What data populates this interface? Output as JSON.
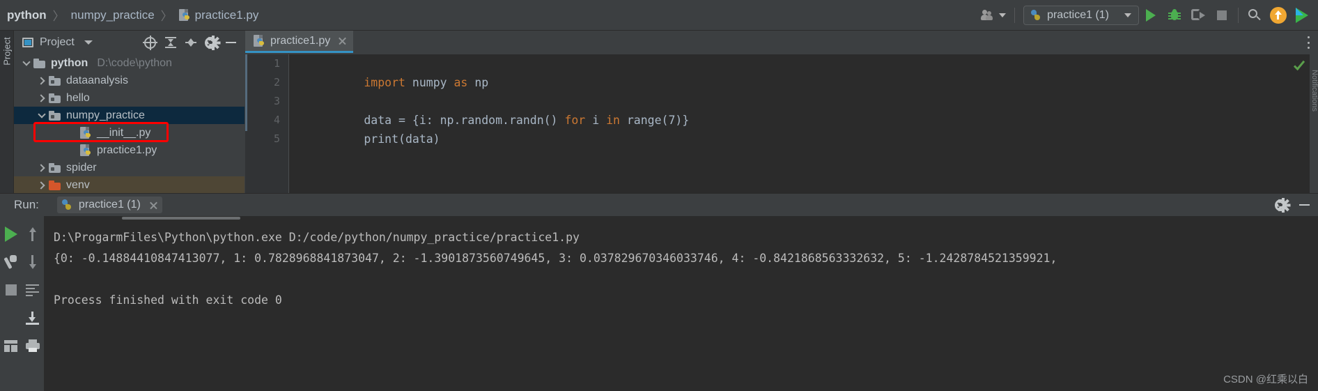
{
  "breadcrumb": {
    "items": [
      "python",
      "numpy_practice",
      "practice1.py"
    ],
    "separator": "〉"
  },
  "toolbar": {
    "run_config_label": "practice1 (1)",
    "icons": [
      "people-icon",
      "run-icon",
      "debug-icon",
      "coverage-icon",
      "stop-icon",
      "search-icon",
      "update-icon",
      "plugin-icon"
    ]
  },
  "left_strip": {
    "label": "Project"
  },
  "right_strip": {
    "label": "Notifications"
  },
  "project_panel": {
    "title": "Project",
    "header_icons": [
      "locate-icon",
      "collapse-all-icon",
      "expand-all-icon",
      "gear-icon",
      "minimize-icon"
    ],
    "tree": [
      {
        "label": "python",
        "path": "D:\\code\\python",
        "type": "root-folder",
        "expanded": true,
        "indent": 0,
        "bold": true
      },
      {
        "label": "dataanalysis",
        "path": "",
        "type": "source-folder",
        "expanded": false,
        "indent": 1,
        "bold": false
      },
      {
        "label": "hello",
        "path": "",
        "type": "source-folder",
        "expanded": false,
        "indent": 1,
        "bold": false
      },
      {
        "label": "numpy_practice",
        "path": "",
        "type": "source-folder",
        "expanded": true,
        "indent": 1,
        "bold": false,
        "selected": true,
        "highlighted": true
      },
      {
        "label": "__init__.py",
        "path": "",
        "type": "python-file",
        "indent": 2,
        "bold": false
      },
      {
        "label": "practice1.py",
        "path": "",
        "type": "python-file",
        "indent": 2,
        "bold": false
      },
      {
        "label": "spider",
        "path": "",
        "type": "source-folder",
        "expanded": false,
        "indent": 1,
        "bold": false
      },
      {
        "label": "venv",
        "path": "",
        "type": "excluded-folder",
        "expanded": false,
        "indent": 1,
        "bold": false,
        "venv_selected": true
      }
    ]
  },
  "editor": {
    "tab": {
      "label": "practice1.py",
      "close": "×"
    },
    "lines": [
      {
        "num": "1",
        "tokens": [
          {
            "t": "import ",
            "k": true
          },
          {
            "t": "numpy ",
            "k": false
          },
          {
            "t": "as ",
            "k": true
          },
          {
            "t": "np",
            "k": false
          }
        ]
      },
      {
        "num": "2",
        "tokens": []
      },
      {
        "num": "3",
        "tokens": [
          {
            "t": "data = {i: np.random.randn() ",
            "k": false
          },
          {
            "t": "for ",
            "k": true
          },
          {
            "t": "i ",
            "k": false
          },
          {
            "t": "in ",
            "k": true
          },
          {
            "t": "range(7)}",
            "k": false
          }
        ]
      },
      {
        "num": "4",
        "tokens": [
          {
            "t": "print(data)",
            "k": false
          }
        ]
      },
      {
        "num": "5",
        "tokens": []
      }
    ],
    "inspection_status": "ok-check-icon"
  },
  "run_window": {
    "label": "Run:",
    "tab_label": "practice1 (1)",
    "tab_close": "×",
    "header_icons": [
      "gear-icon",
      "minimize-icon"
    ],
    "side_icons": [
      "rerun-icon",
      "up-arrow-icon",
      "wrench-icon",
      "down-arrow-icon",
      "stop-icon",
      "soft-wrap-icon",
      "scroll-to-end-icon",
      "print-icon",
      "grid-icon"
    ],
    "console": [
      "D:\\ProgarmFiles\\Python\\python.exe D:/code/python/numpy_practice/practice1.py",
      "{0: -0.14884410847413077, 1: 0.7828968841873047, 2: -1.3901873560749645, 3: 0.037829670346033746, 4: -0.8421868563332632, 5: -1.2428784521359921,",
      "",
      "Process finished with exit code 0"
    ]
  },
  "watermark": "CSDN @红乘以白",
  "colors": {
    "accent": "#3592c4",
    "keyword": "#cc7832",
    "selection": "#0d293e",
    "highlight_box": "#fe0000",
    "venv_row": "#4e4635"
  }
}
